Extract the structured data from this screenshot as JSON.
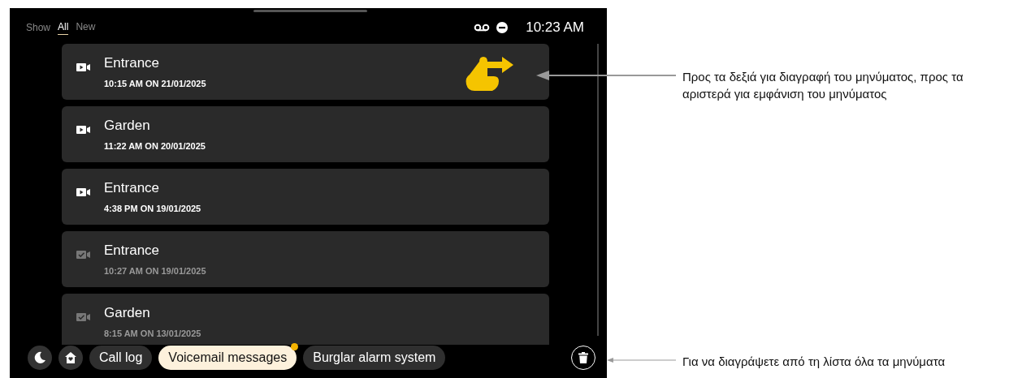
{
  "filter": {
    "label": "Show",
    "options": [
      {
        "label": "All",
        "selected": true
      },
      {
        "label": "New",
        "selected": false
      }
    ]
  },
  "status_bar": {
    "time": "10:23 AM"
  },
  "messages": [
    {
      "name": "Entrance",
      "time": "10:15 AM ON 21/01/2025",
      "read": false,
      "swipe_hint": true
    },
    {
      "name": "Garden",
      "time": "11:22 AM ON 20/01/2025",
      "read": false,
      "swipe_hint": false
    },
    {
      "name": "Entrance",
      "time": "4:38 PM ON 19/01/2025",
      "read": false,
      "swipe_hint": false
    },
    {
      "name": "Entrance",
      "time": "10:27 AM ON 19/01/2025",
      "read": true,
      "swipe_hint": false
    },
    {
      "name": "Garden",
      "time": "8:15 AM ON 13/01/2025",
      "read": true,
      "swipe_hint": false
    }
  ],
  "nav": {
    "tabs": [
      {
        "label": "Call log",
        "selected": false,
        "notification": false
      },
      {
        "label": "Voicemail messages",
        "selected": true,
        "notification": true
      },
      {
        "label": "Burglar alarm system",
        "selected": false,
        "notification": false
      }
    ]
  },
  "annotations": [
    {
      "kind": "swipe",
      "text": "Προς τα δεξιά για διαγραφή του μηνύματος, προς τα αριστερά για εμφάνιση του μηνύματος"
    },
    {
      "kind": "delete",
      "text": "Για να διαγράψετε από τη λίστα όλα τα μηνύματα"
    }
  ]
}
